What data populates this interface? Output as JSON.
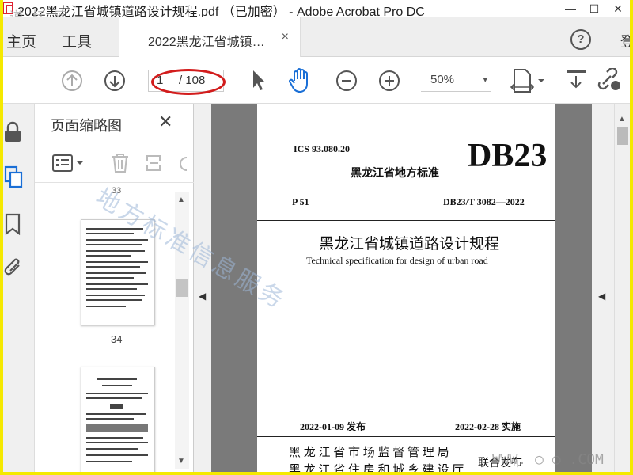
{
  "window": {
    "title": "2022黑龙江省城镇道路设计规程.pdf （已加密） - Adobe Acrobat Pro DC",
    "watermark_top": "道 标 网",
    "controls": [
      "—",
      "☐",
      "✕"
    ]
  },
  "menu": {
    "home": "主页",
    "tools": "工具",
    "tab_title": "2022黑龙江省城镇…",
    "tab_close": "×",
    "help": "?",
    "signin": "登"
  },
  "toolbar": {
    "page_current": "1",
    "page_total": "/ 108",
    "zoom": "50%",
    "zoom_caret": "▾"
  },
  "panel": {
    "title": "页面缩略图",
    "close": "✕",
    "thumb_labels": [
      "33",
      "34"
    ]
  },
  "document": {
    "ics": "ICS 93.080.20",
    "std_code": "DB23",
    "std_type": "黑龙江省地方标准",
    "p_code": "P 51",
    "std_number": "DB23/T 3082—2022",
    "title_cn": "黑龙江省城镇道路设计规程",
    "title_en": "Technical specification for design of urban road",
    "issued": "2022-01-09 发布",
    "implemented": "2022-02-28 实施",
    "issuer_1": "黑 龙 江 省 市 场 监 督 管 理 局",
    "issuer_2": "黑 龙 江 省 住 房 和 城 乡 建 设 厅",
    "joint": "联合发布",
    "watermark": "地方标准信息服务",
    "watermark_url": "WWW. ○   ○ .COM"
  }
}
